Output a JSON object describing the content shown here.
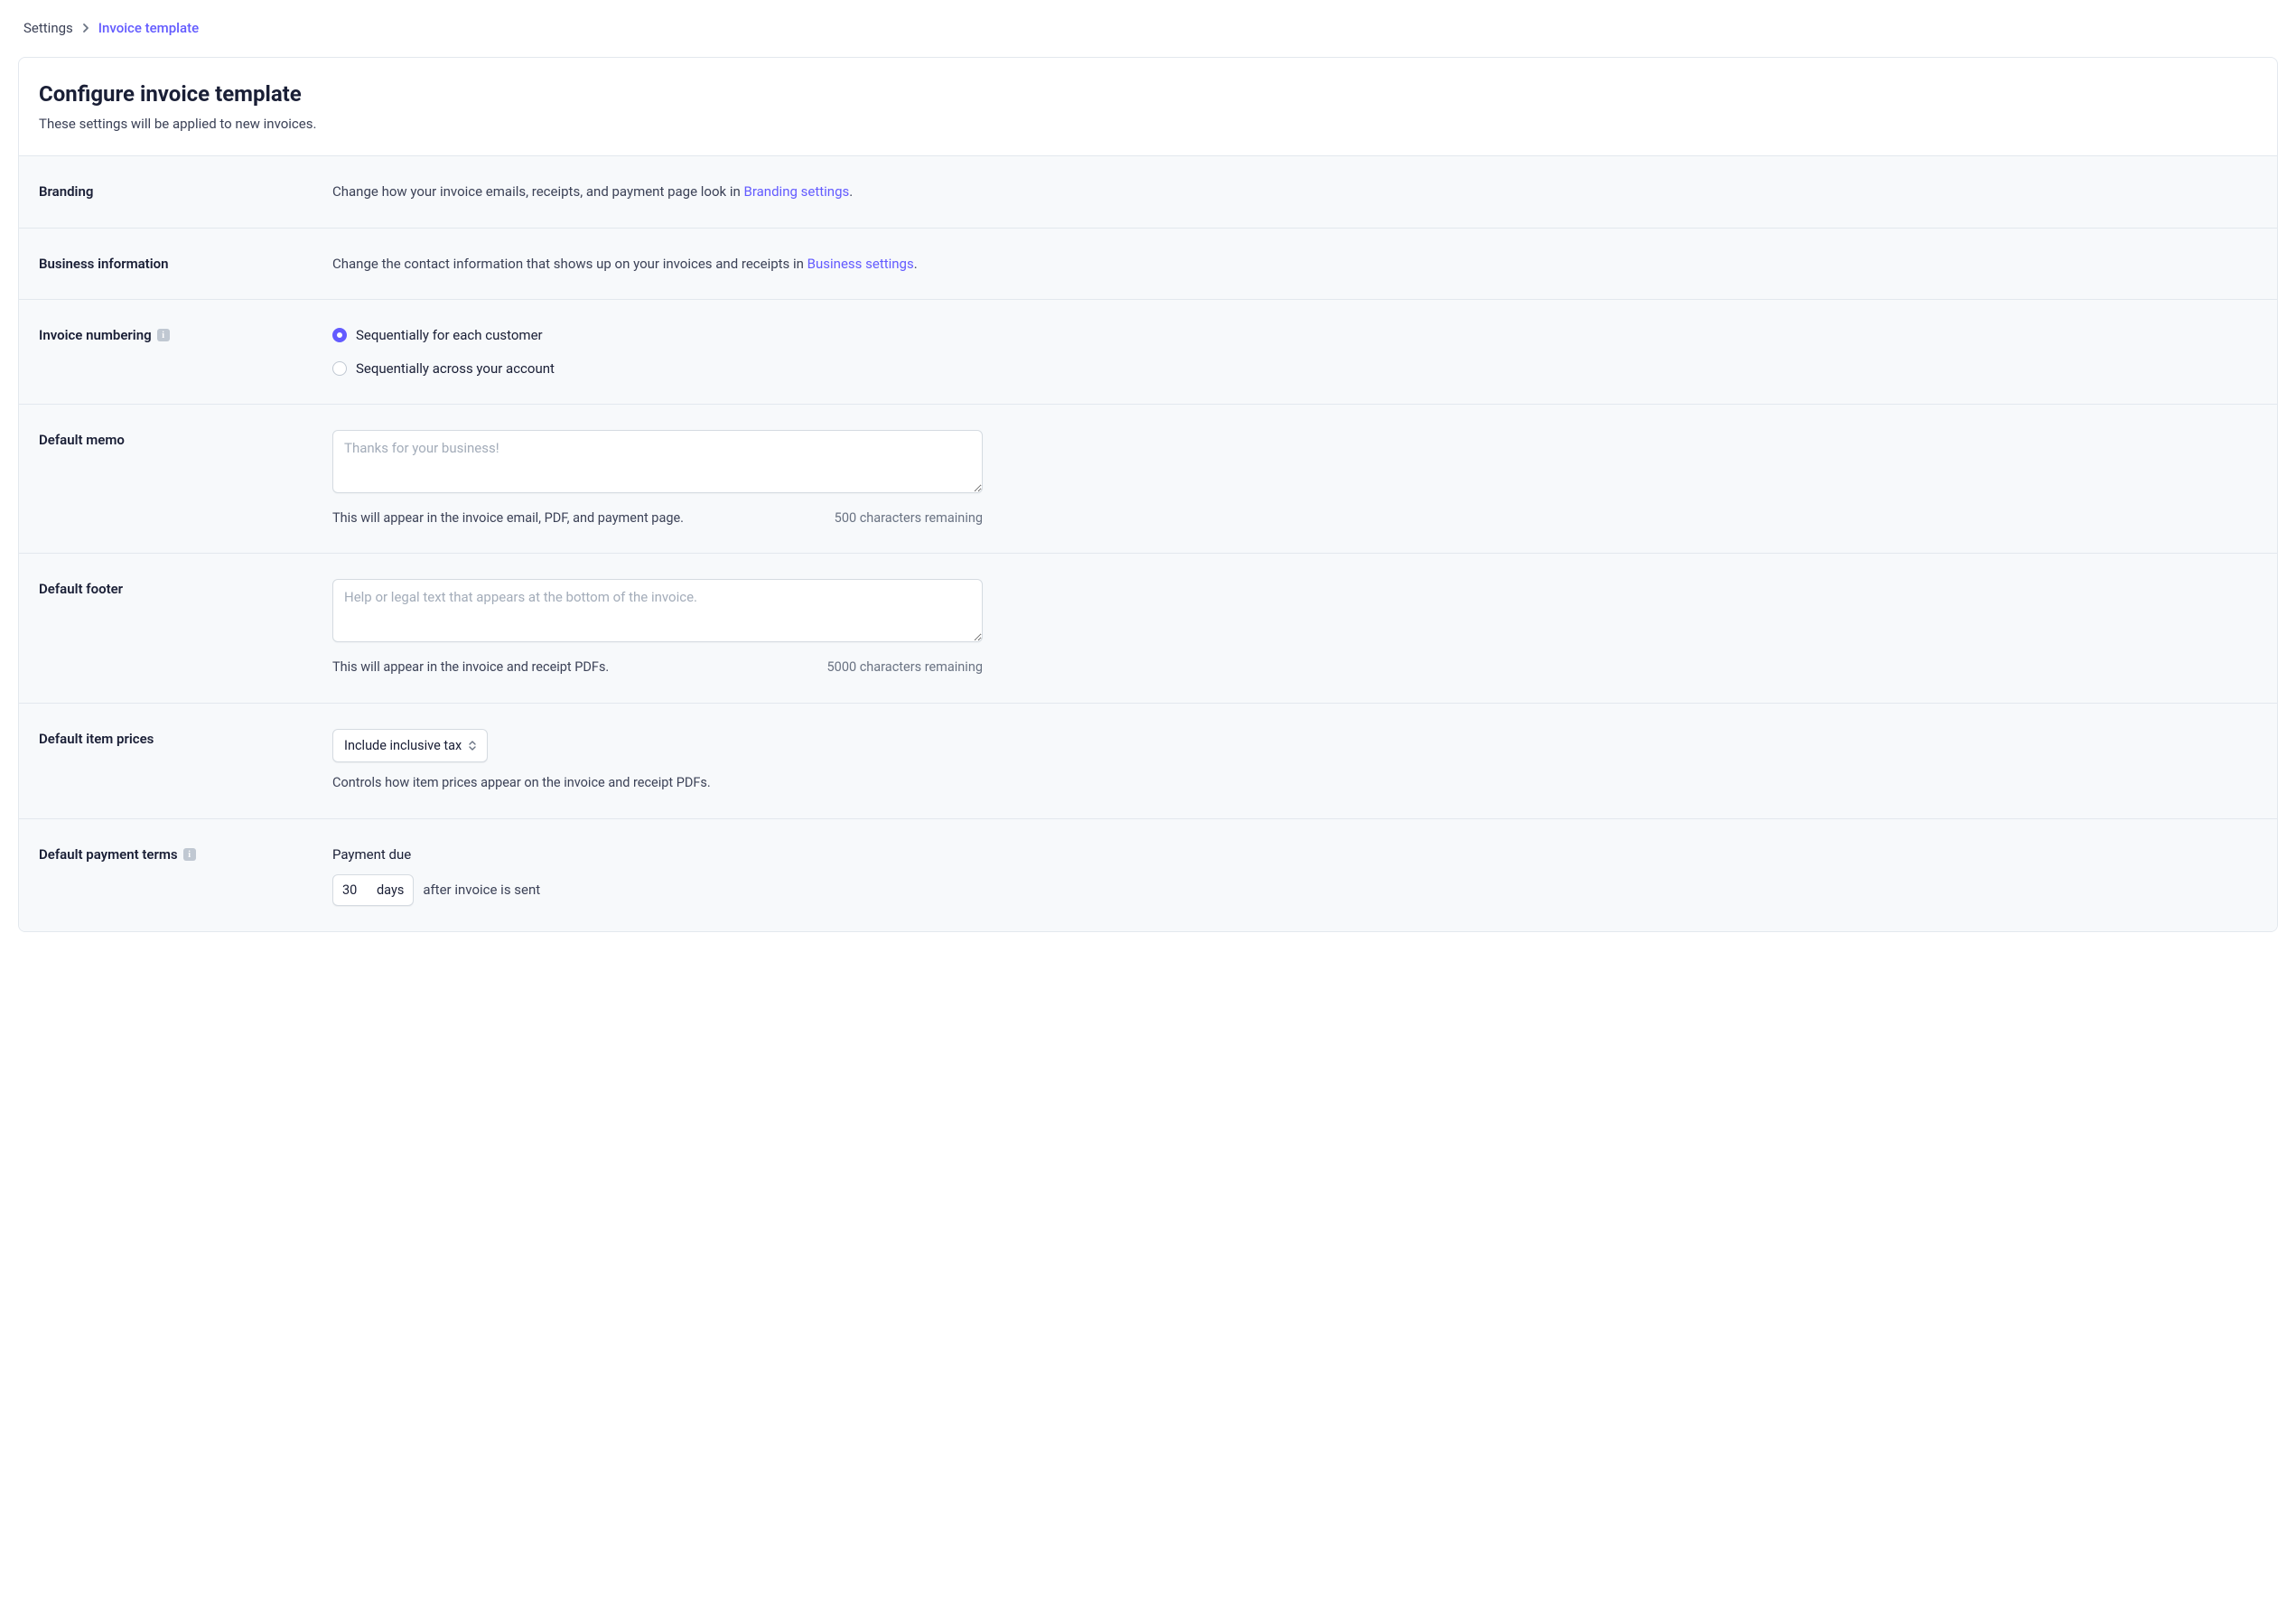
{
  "breadcrumb": {
    "parent": "Settings",
    "current": "Invoice template"
  },
  "header": {
    "title": "Configure invoice template",
    "subtitle": "These settings will be applied to new invoices."
  },
  "branding": {
    "label": "Branding",
    "text_prefix": "Change how your invoice emails, receipts, and payment page look in ",
    "link_text": "Branding settings",
    "text_suffix": "."
  },
  "business": {
    "label": "Business information",
    "text_prefix": "Change the contact information that shows up on your invoices and receipts in ",
    "link_text": "Business settings",
    "text_suffix": "."
  },
  "numbering": {
    "label": "Invoice numbering",
    "option_customer": "Sequentially for each customer",
    "option_account": "Sequentially across your account"
  },
  "memo": {
    "label": "Default memo",
    "placeholder": "Thanks for your business!",
    "help": "This will appear in the invoice email, PDF, and payment page.",
    "remaining": "500 characters remaining"
  },
  "footer": {
    "label": "Default footer",
    "placeholder": "Help or legal text that appears at the bottom of the invoice.",
    "help": "This will appear in the invoice and receipt PDFs.",
    "remaining": "5000 characters remaining"
  },
  "item_prices": {
    "label": "Default item prices",
    "select_value": "Include inclusive tax",
    "help": "Controls how item prices appear on the invoice and receipt PDFs."
  },
  "payment_terms": {
    "label": "Default payment terms",
    "sub_label": "Payment due",
    "days_value": "30",
    "days_unit": "days",
    "after_text": "after invoice is sent"
  }
}
